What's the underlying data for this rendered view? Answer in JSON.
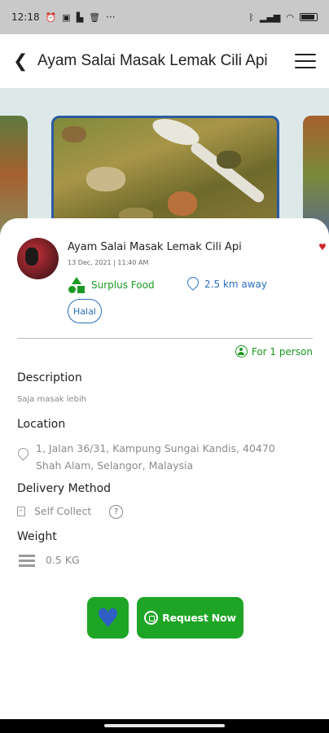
{
  "status_bar": {
    "time": "12:18",
    "dots": "···"
  },
  "header": {
    "title": "Ayam Salai Masak Lemak Cili Api"
  },
  "listing": {
    "name": "Ayam Salai Masak Lemak Cili Api",
    "date": "13 Dec, 2021 | 11:40 AM",
    "category": "Surplus Food",
    "distance": "2.5 km away",
    "badge": "Halal",
    "serving": "For 1 person"
  },
  "sections": {
    "description": {
      "heading": "Description",
      "text": "Saja masak lebih"
    },
    "location": {
      "heading": "Location",
      "line1": "1, Jalan 36/31, Kampung Sungai Kandis, 40470",
      "line2": "Shah Alam, Selangor, Malaysia"
    },
    "delivery": {
      "heading": "Delivery Method",
      "value": "Self Collect",
      "help_glyph": "?"
    },
    "weight": {
      "heading": "Weight",
      "value": "0.5 KG"
    }
  },
  "actions": {
    "request_label": "Request Now"
  },
  "icons": {
    "back": "back-arrow-icon",
    "menu": "hamburger-menu-icon",
    "favorite": "heart-icon",
    "whatsapp": "whatsapp-icon"
  },
  "colors": {
    "accent_green": "#1fa526",
    "link_blue": "#2a6fbd",
    "heart_red": "#d0242c"
  }
}
